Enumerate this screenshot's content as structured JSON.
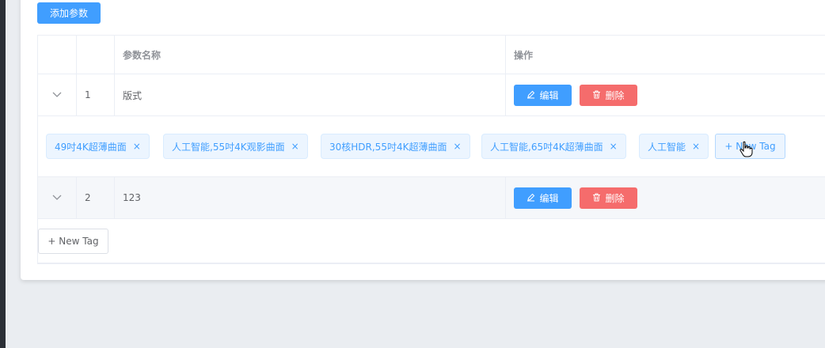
{
  "toolbar": {
    "add_param_label": "添加参数"
  },
  "table": {
    "headers": {
      "index": "",
      "name": "参数名称",
      "ops": "操作"
    },
    "rows": [
      {
        "index": "1",
        "name": "版式",
        "edit_label": "编辑",
        "delete_label": "删除"
      },
      {
        "index": "2",
        "name": "123",
        "edit_label": "编辑",
        "delete_label": "删除"
      }
    ],
    "row1_tags": [
      "49吋4K超薄曲面",
      "人工智能,55吋4K观影曲面",
      "30核HDR,55吋4K超薄曲面",
      "人工智能,65吋4K超薄曲面",
      "人工智能"
    ],
    "tag_close_symbol": "×",
    "new_tag_label": "+ New Tag",
    "row2_new_tag_label": "+ New Tag"
  },
  "icons": {
    "expand": "chevron-down-icon",
    "edit": "edit-icon",
    "delete": "trash-icon",
    "cursor": "hand-pointer-cursor"
  },
  "colors": {
    "primary": "#409eff",
    "danger": "#f56c6c",
    "tag_bg": "#ecf5ff"
  }
}
